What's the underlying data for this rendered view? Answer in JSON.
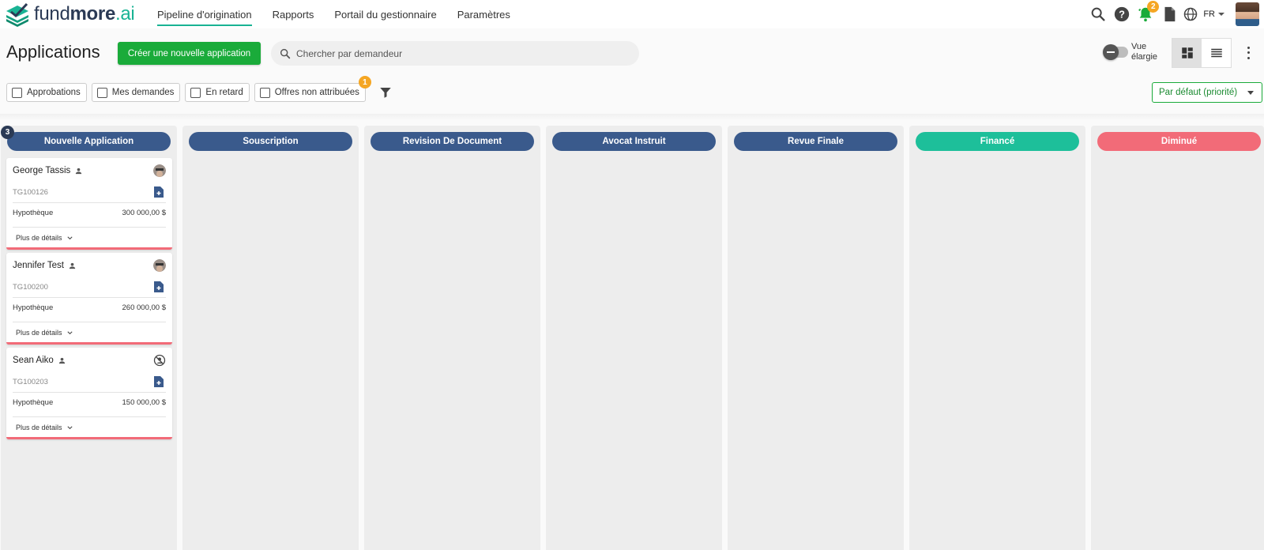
{
  "brand": {
    "part1": "fund",
    "part2": "more",
    "part3": ".ai"
  },
  "nav": {
    "links": [
      "Pipeline d'origination",
      "Rapports",
      "Portail du gestionnaire",
      "Paramètres"
    ],
    "notification_count": "2",
    "language": "FR"
  },
  "page": {
    "title": "Applications",
    "create_button": "Créer une nouvelle application",
    "search_placeholder": "Chercher par demandeur",
    "toggle_label": "Vue élargie"
  },
  "filters": {
    "chips": [
      "Approbations",
      "Mes demandes",
      "En retard",
      "Offres non attribuées"
    ],
    "unassigned_badge": "1",
    "sort": "Par défaut (priorité)"
  },
  "colors": {
    "accent_green": "#1aab3a",
    "brand_teal": "#19b394",
    "column_blue": "#3a5a8c",
    "finance_green": "#1dbf9a",
    "declined_red": "#f26b78",
    "badge_orange": "#f5a623"
  },
  "columns": [
    {
      "label": "Nouvelle Application",
      "count": "3",
      "color": "#3a5a8c"
    },
    {
      "label": "Souscription",
      "color": "#3a5a8c"
    },
    {
      "label": "Revision De Document",
      "color": "#3a5a8c"
    },
    {
      "label": "Avocat Instruit",
      "color": "#3a5a8c"
    },
    {
      "label": "Revue Finale",
      "color": "#3a5a8c"
    },
    {
      "label": "Financé",
      "color": "#1dbf9a"
    },
    {
      "label": "Diminué",
      "color": "#f26b78"
    }
  ],
  "cards": [
    {
      "name": "George Tassis",
      "id": "TG100126",
      "type": "Hypothèque",
      "amount": "300 000,00 $",
      "details": "Plus de détails",
      "assignee": "photo-avatar"
    },
    {
      "name": "Jennifer Test",
      "id": "TG100200",
      "type": "Hypothèque",
      "amount": "260 000,00 $",
      "details": "Plus de détails",
      "assignee": "photo-avatar"
    },
    {
      "name": "Sean Aiko",
      "id": "TG100203",
      "type": "Hypothèque",
      "amount": "150 000,00 $",
      "details": "Plus de détails",
      "assignee": "unassigned-icon"
    }
  ]
}
